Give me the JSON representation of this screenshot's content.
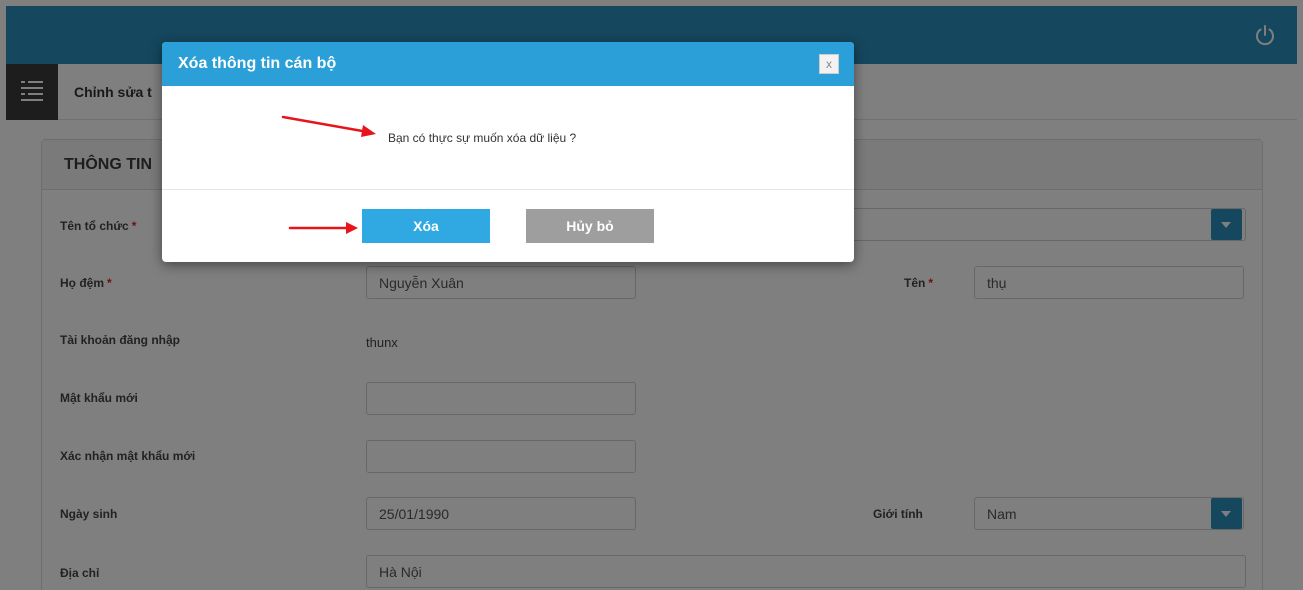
{
  "header": {
    "power_icon": "power-icon",
    "menu_icon": "menu-list-icon",
    "page_title": "Chỉnh sửa t"
  },
  "panel": {
    "title": "THÔNG TIN"
  },
  "form": {
    "org_label": "Tên tổ chức",
    "org_value": "",
    "middle_name_label": "Họ đệm",
    "middle_name_value": "Nguyễn Xuân",
    "first_name_label": "Tên",
    "first_name_value": "thụ",
    "account_label": "Tài khoản đăng nhập",
    "account_value": "thunx",
    "new_password_label": "Mật khẩu mới",
    "new_password_value": "",
    "confirm_password_label": "Xác nhận mật khẩu mới",
    "confirm_password_value": "",
    "dob_label": "Ngày sinh",
    "dob_value": "25/01/1990",
    "gender_label": "Giới tính",
    "gender_value": "Nam",
    "address_label": "Địa chỉ",
    "address_value": "Hà Nội",
    "required_mark": "*"
  },
  "modal": {
    "title": "Xóa thông tin cán bộ",
    "close_label": "x",
    "message": "Bạn có thực sự muốn xóa dữ liệu ?",
    "confirm_label": "Xóa",
    "cancel_label": "Hủy bỏ"
  },
  "colors": {
    "topbar": "#2a8fbd",
    "modal_header": "#2a9fd8",
    "confirm_button": "#30a9e3",
    "cancel_button": "#9e9e9e",
    "annotation_arrow": "#e8141c"
  }
}
